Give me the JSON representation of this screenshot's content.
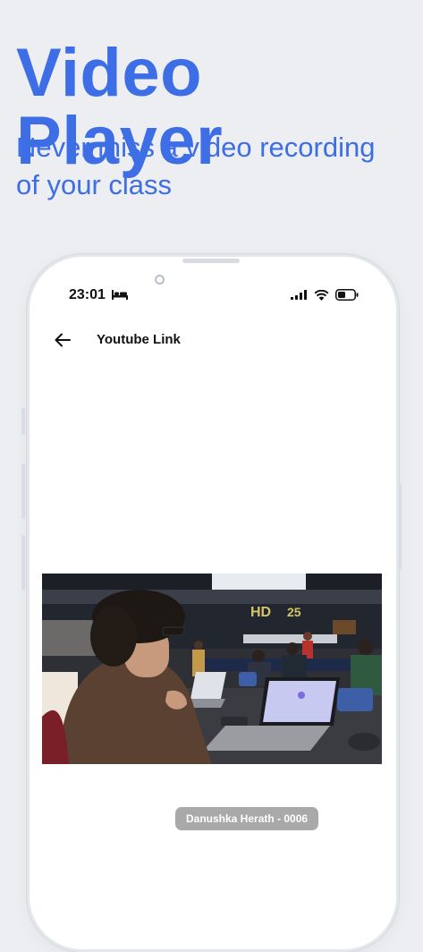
{
  "promo": {
    "title": "Video Player",
    "subtitle": "Never miss a video recording of your class"
  },
  "status_bar": {
    "time": "23:01",
    "icons": [
      "bed-icon",
      "signal-icon",
      "wifi-icon",
      "battery-icon"
    ]
  },
  "app_bar": {
    "back_icon": "arrow-left-icon",
    "title": "Youtube Link"
  },
  "video": {
    "watermark": "Danushka Herath - 0006"
  },
  "colors": {
    "accent": "#3d6ee6",
    "page_background": "#eceef1",
    "watermark_background": "#a9a9a9"
  }
}
